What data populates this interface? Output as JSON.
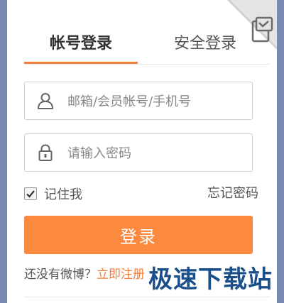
{
  "tabs": {
    "account": "帐号登录",
    "secure": "安全登录"
  },
  "form": {
    "username_placeholder": "邮箱/会员帐号/手机号",
    "password_placeholder": "请输入密码",
    "remember_label": "记住我",
    "remember_checked": true,
    "forgot_label": "忘记密码",
    "login_label": "登录"
  },
  "signup": {
    "prompt": "还没有微博？",
    "link": "立即注册"
  },
  "watermark": "极速下载站",
  "colors": {
    "accent": "#f47f3a",
    "button": "#fb8a3f",
    "background": "#7b8bb0"
  },
  "icons": {
    "corner": "qr-switch-icon",
    "user": "user-icon",
    "password": "lock-icon",
    "check": "check-icon"
  }
}
